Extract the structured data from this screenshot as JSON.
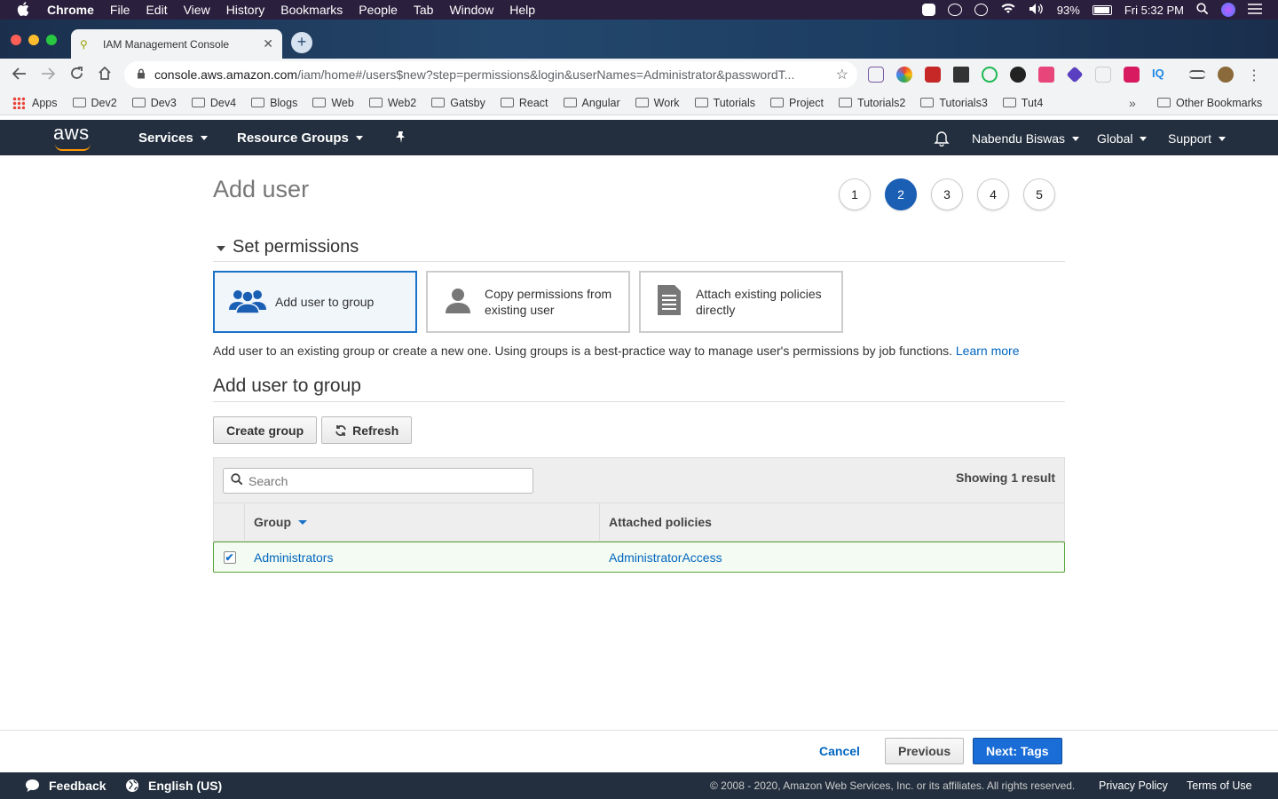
{
  "os_menubar": {
    "app": "Chrome",
    "items": [
      "File",
      "Edit",
      "View",
      "History",
      "Bookmarks",
      "People",
      "Tab",
      "Window",
      "Help"
    ],
    "battery": "93%",
    "clock": "Fri 5:32 PM"
  },
  "browser": {
    "tab_title": "IAM Management Console",
    "url_host": "console.aws.amazon.com",
    "url_path": "/iam/home#/users$new?step=permissions&login&userNames=Administrator&passwordT...",
    "bookmarks": [
      "Apps",
      "Dev2",
      "Dev3",
      "Dev4",
      "Blogs",
      "Web",
      "Web2",
      "Gatsby",
      "React",
      "Angular",
      "Work",
      "Tutorials",
      "Project",
      "Tutorials2",
      "Tutorials3",
      "Tut4"
    ],
    "bookmarks_more": "»",
    "other_bookmarks": "Other Bookmarks"
  },
  "aws_nav": {
    "logo": "aws",
    "services": "Services",
    "resource_groups": "Resource Groups",
    "user": "Nabendu Biswas",
    "region": "Global",
    "support": "Support"
  },
  "page": {
    "title": "Add user",
    "steps": [
      "1",
      "2",
      "3",
      "4",
      "5"
    ],
    "active_step": "2",
    "set_permissions": "Set permissions",
    "options": {
      "add_to_group": "Add user to group",
      "copy_permissions": "Copy permissions from existing user",
      "attach_policies": "Attach existing policies directly"
    },
    "description": "Add user to an existing group or create a new one. Using groups is a best-practice way to manage user's permissions by job functions.",
    "learn_more": "Learn more",
    "add_to_group_heading": "Add user to group",
    "create_group": "Create group",
    "refresh": "Refresh"
  },
  "table": {
    "search_placeholder": "Search",
    "showing": "Showing 1 result",
    "columns": [
      "Group",
      "Attached policies"
    ],
    "rows": [
      {
        "group": "Administrators",
        "policies": "AdministratorAccess",
        "checked": true
      }
    ]
  },
  "wizard": {
    "cancel": "Cancel",
    "previous": "Previous",
    "next": "Next: Tags"
  },
  "footer": {
    "feedback": "Feedback",
    "language": "English (US)",
    "copyright": "© 2008 - 2020, Amazon Web Services, Inc. or its affiliates. All rights reserved.",
    "privacy": "Privacy Policy",
    "terms": "Terms of Use"
  },
  "colors": {
    "aws_nav_bg": "#232f3e",
    "aws_orange": "#ff9900",
    "primary_blue": "#1a6dd6",
    "link_blue": "#0066c0",
    "selected_row_border": "#5aa53a"
  }
}
